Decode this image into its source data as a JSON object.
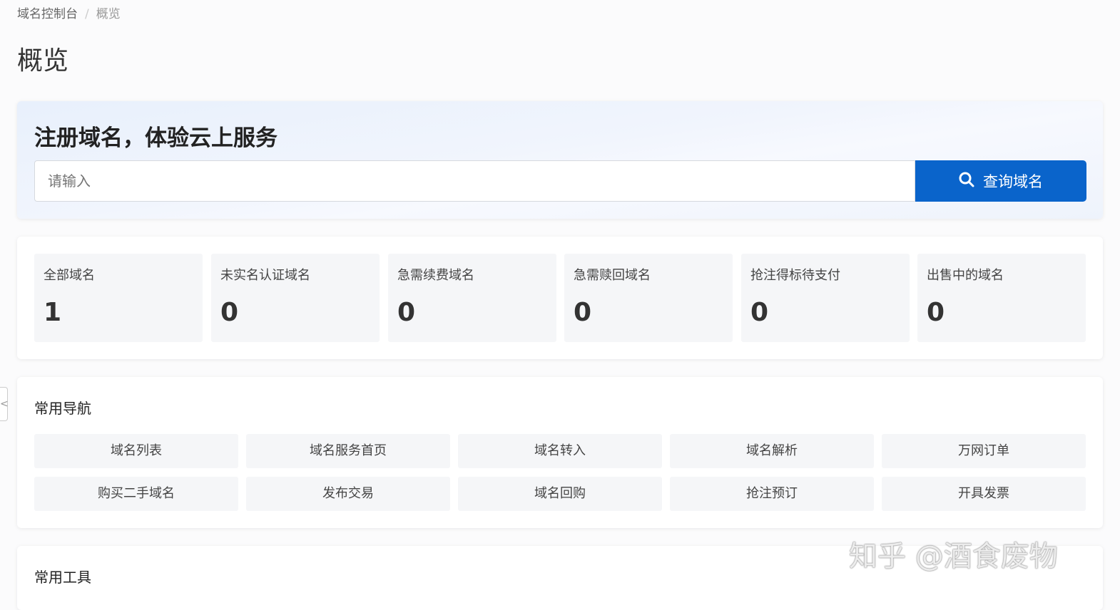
{
  "breadcrumb": {
    "root": "域名控制台",
    "separator": "/",
    "current": "概览"
  },
  "page_title": "概览",
  "hero": {
    "title": "注册域名，体验云上服务",
    "search_placeholder": "请输入",
    "search_button": "查询域名"
  },
  "stats": [
    {
      "label": "全部域名",
      "value": "1"
    },
    {
      "label": "未实名认证域名",
      "value": "0"
    },
    {
      "label": "急需续费域名",
      "value": "0"
    },
    {
      "label": "急需赎回域名",
      "value": "0"
    },
    {
      "label": "抢注得标待支付",
      "value": "0"
    },
    {
      "label": "出售中的域名",
      "value": "0"
    }
  ],
  "nav": {
    "title": "常用导航",
    "items": [
      "域名列表",
      "域名服务首页",
      "域名转入",
      "域名解析",
      "万网订单",
      "购买二手域名",
      "发布交易",
      "域名回购",
      "抢注预订",
      "开具发票"
    ]
  },
  "tools": {
    "title": "常用工具"
  },
  "sidebar_toggle": "<",
  "watermark": "知乎 @酒食废物",
  "colors": {
    "primary": "#0a64cb"
  }
}
